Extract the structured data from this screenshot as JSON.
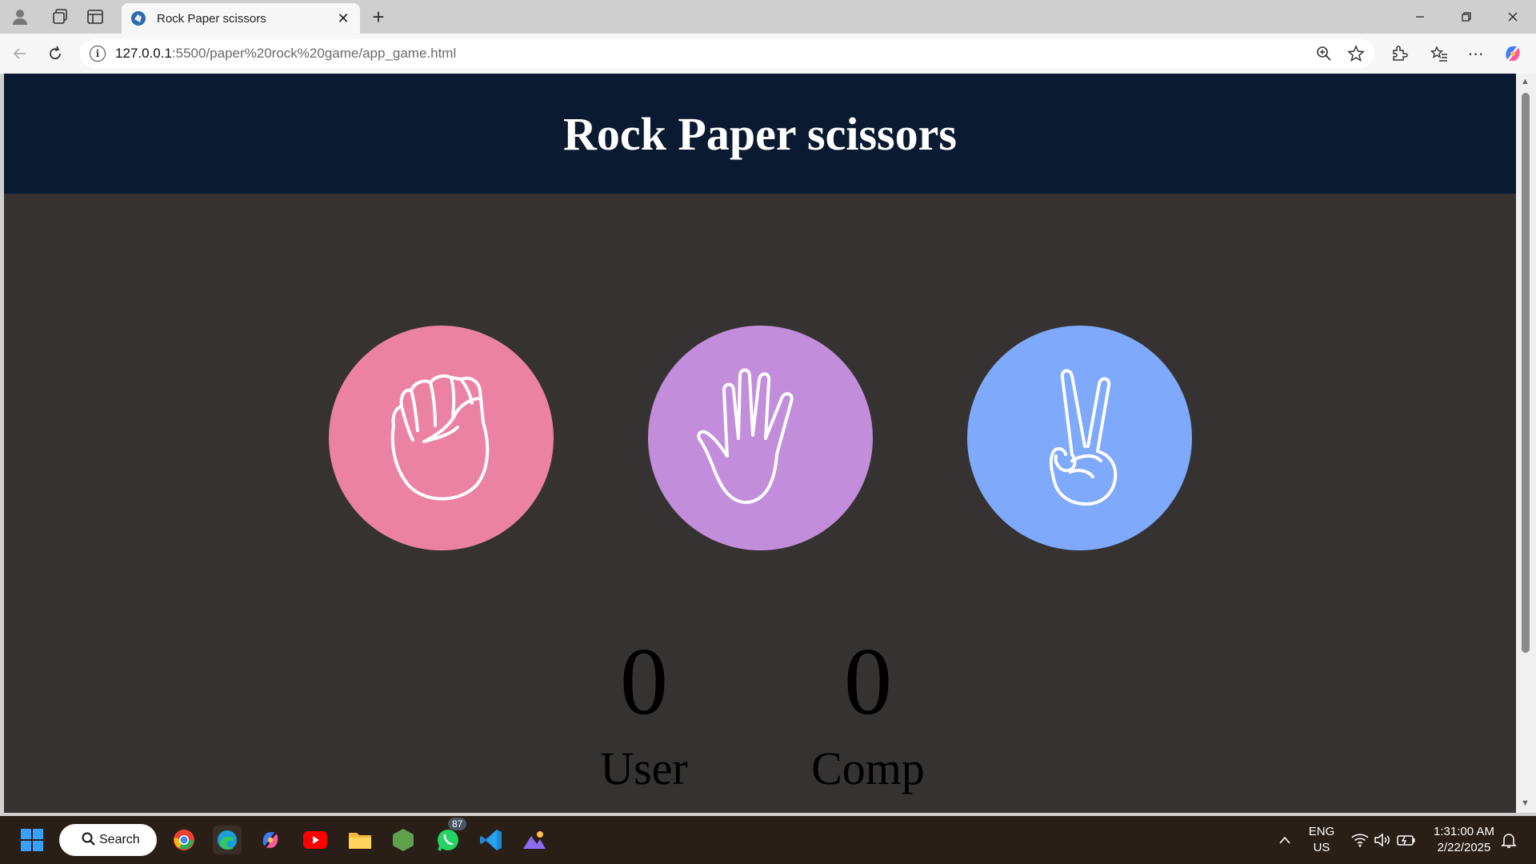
{
  "browser": {
    "tab_title": "Rock Paper scissors",
    "url_host": "127.0.0.1",
    "url_path": ":5500/paper%20rock%20game/app_game.html"
  },
  "page": {
    "title": "Rock Paper scissors",
    "choices": [
      {
        "name": "rock",
        "color": "#ec82a2"
      },
      {
        "name": "paper",
        "color": "#c28ddb"
      },
      {
        "name": "scissors",
        "color": "#7fa9fb"
      }
    ],
    "score": {
      "user_value": "0",
      "user_label": "User",
      "comp_value": "0",
      "comp_label": "Comp"
    },
    "colors": {
      "header_bg": "#0a1a30",
      "body_bg": "#353231"
    }
  },
  "taskbar": {
    "search_label": "Search",
    "whatsapp_badge": "87",
    "language": "ENG",
    "region": "US",
    "time": "1:31:00 AM",
    "date": "2/22/2025"
  }
}
